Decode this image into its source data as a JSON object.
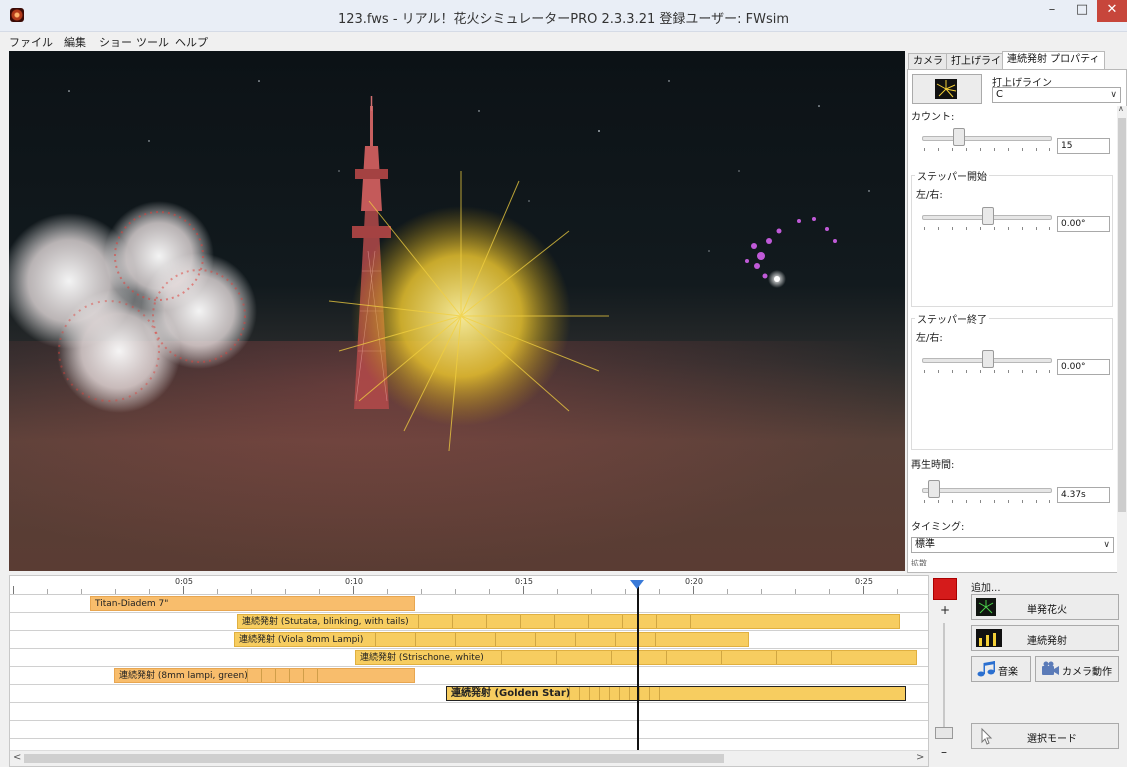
{
  "window": {
    "title": "123.fws - リアル！花火シミュレーターPRO 2.3.3.21 登録ユーザー:  FWsim",
    "min_glyph": "–",
    "max_glyph": "□",
    "close_glyph": "✕"
  },
  "menu": [
    "ファイル",
    "編集",
    "ショー",
    "ツール",
    "ヘルプ"
  ],
  "panel": {
    "tabs": [
      "カメラ",
      "打上げライン",
      "連続発射 プロパティ"
    ],
    "launch_line_label": "打上げライン",
    "launch_line_value": "C",
    "count_label": "カウント:",
    "count_value": "15",
    "stepper_start_label": "ステッパー開始",
    "stepper_start_lr": "左/右:",
    "stepper_start_value": "0.00°",
    "stepper_end_label": "ステッパー終了",
    "stepper_end_lr": "左/右:",
    "stepper_end_value": "0.00°",
    "playtime_label": "再生時間:",
    "playtime_value": "4.37s",
    "timing_label": "タイミング:",
    "timing_value": "標準",
    "cutoff_text": "拡散"
  },
  "timeline": {
    "ruler": [
      "0:05",
      "0:10",
      "0:15",
      "0:20",
      "0:25"
    ],
    "bars": [
      {
        "label": "Titan-Diadem 7\"",
        "style": "orange"
      },
      {
        "label": "連続発射 (Stutata, blinking, with tails)",
        "style": "yellow"
      },
      {
        "label": "連続発射 (Viola 8mm Lampi)",
        "style": "yellow"
      },
      {
        "label": "連続発射 (Strischone, white)",
        "style": "yellow"
      },
      {
        "label": "連続発射 (8mm lampi, green)",
        "style": "orange"
      },
      {
        "label": "連続発射 (Golden Star)",
        "style": "bold"
      }
    ]
  },
  "add_panel": {
    "title": "追加...",
    "single_label": "単発花火",
    "cake_label": "連続発射",
    "music_label": "音楽",
    "camera_label": "カメラ動作",
    "select_label": "選択モード"
  },
  "icons": {
    "app": "app-icon",
    "music": "music-note-icon",
    "camera": "camera-icon",
    "cursor": "cursor-icon"
  },
  "colors": {
    "bar_yellow": "#f7cd60",
    "bar_orange": "#f8bd6c",
    "record": "#d51b1b",
    "close": "#c7463b"
  }
}
